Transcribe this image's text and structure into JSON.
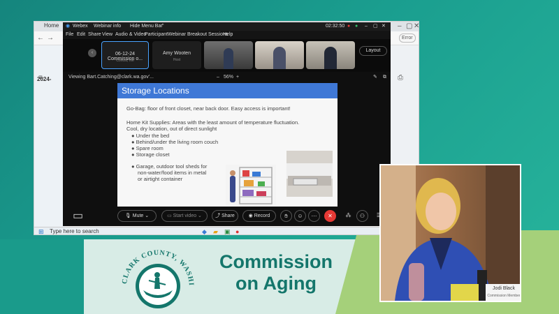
{
  "banner": {
    "org_title_line1": "Commission",
    "org_title_line2": "on Aging",
    "seal_text": "CLARK COUNTY, WASHINGTON"
  },
  "browser": {
    "tab_home": "Home",
    "bookmark": "2024-",
    "taskbar_search": "Type here to search",
    "profile_label": "Error"
  },
  "webex": {
    "app_name": "Webex",
    "webinar_info": "Webinar info",
    "hide_menu": "Hide Menu Bar",
    "clock": "02:32:50",
    "menu": [
      "File",
      "Edit",
      "Share",
      "View",
      "Audio & Video",
      "Participant",
      "Webinar",
      "Breakout Sessions",
      "Help"
    ],
    "layout_label": "Layout",
    "participants": [
      {
        "name": "06-12-24 Commission o...",
        "sub": "Cohost, me"
      },
      {
        "name": "Amy Wooten",
        "sub": "Host"
      }
    ],
    "viewing": "Viewing Bart.Catching@clark.wa.gov'...",
    "zoom": "56%",
    "controls": {
      "mute": "Mute",
      "video": "Start video",
      "share": "Share",
      "record": "Record"
    }
  },
  "slide": {
    "title": "Storage Locations",
    "go_bag": "Go-Bag: floor of front closet, near back door. Easy access is important!",
    "home_kit_1": "Home Kit Supplies: Areas with the least amount of temperature fluctuation.",
    "home_kit_2": "Cool, dry location, out of direct sunlight",
    "bullets": [
      "Under the bed",
      "Behind/under the living room couch",
      "Spare room",
      "Storage closet"
    ],
    "garage_1": "Garage, outdoor tool sheds for",
    "garage_2": "non-water/food items in metal",
    "garage_3": "or airtight container"
  },
  "camera": {
    "nameplate_name": "Jodi Black",
    "nameplate_sub": "Commission Member"
  },
  "colors": {
    "teal": "#1a9b8b",
    "slide_blue": "#3f78d6",
    "leave_red": "#e53935"
  }
}
